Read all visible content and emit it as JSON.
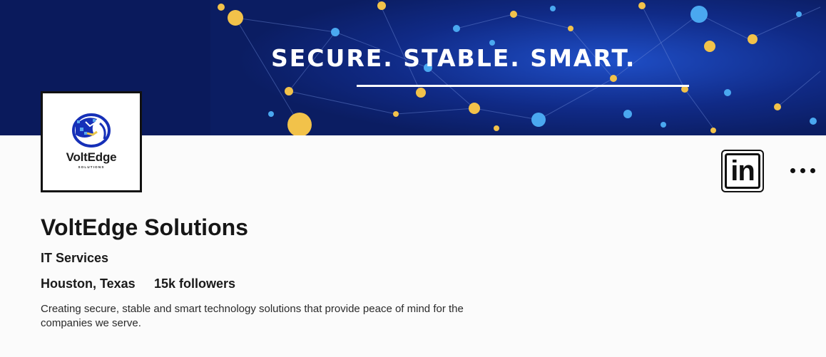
{
  "banner": {
    "tagline": "SECURE. STABLE. SMART.",
    "background_color": "#0b1d62",
    "node_colors": [
      "#f2c24a",
      "#4aa8f0"
    ]
  },
  "logo": {
    "name": "VoltEdge",
    "subtitle": "SOLUTIONS",
    "icon": "globe-icon"
  },
  "actions": {
    "linkedin_label": "in",
    "linkedin_icon": "linkedin-icon",
    "more_icon": "more-options-icon"
  },
  "profile": {
    "company_name": "VoltEdge Solutions",
    "industry": "IT Services",
    "location": "Houston, Texas",
    "followers": "15k followers",
    "description": "Creating secure, stable and smart technology solutions that provide peace of mind for the companies we serve."
  }
}
